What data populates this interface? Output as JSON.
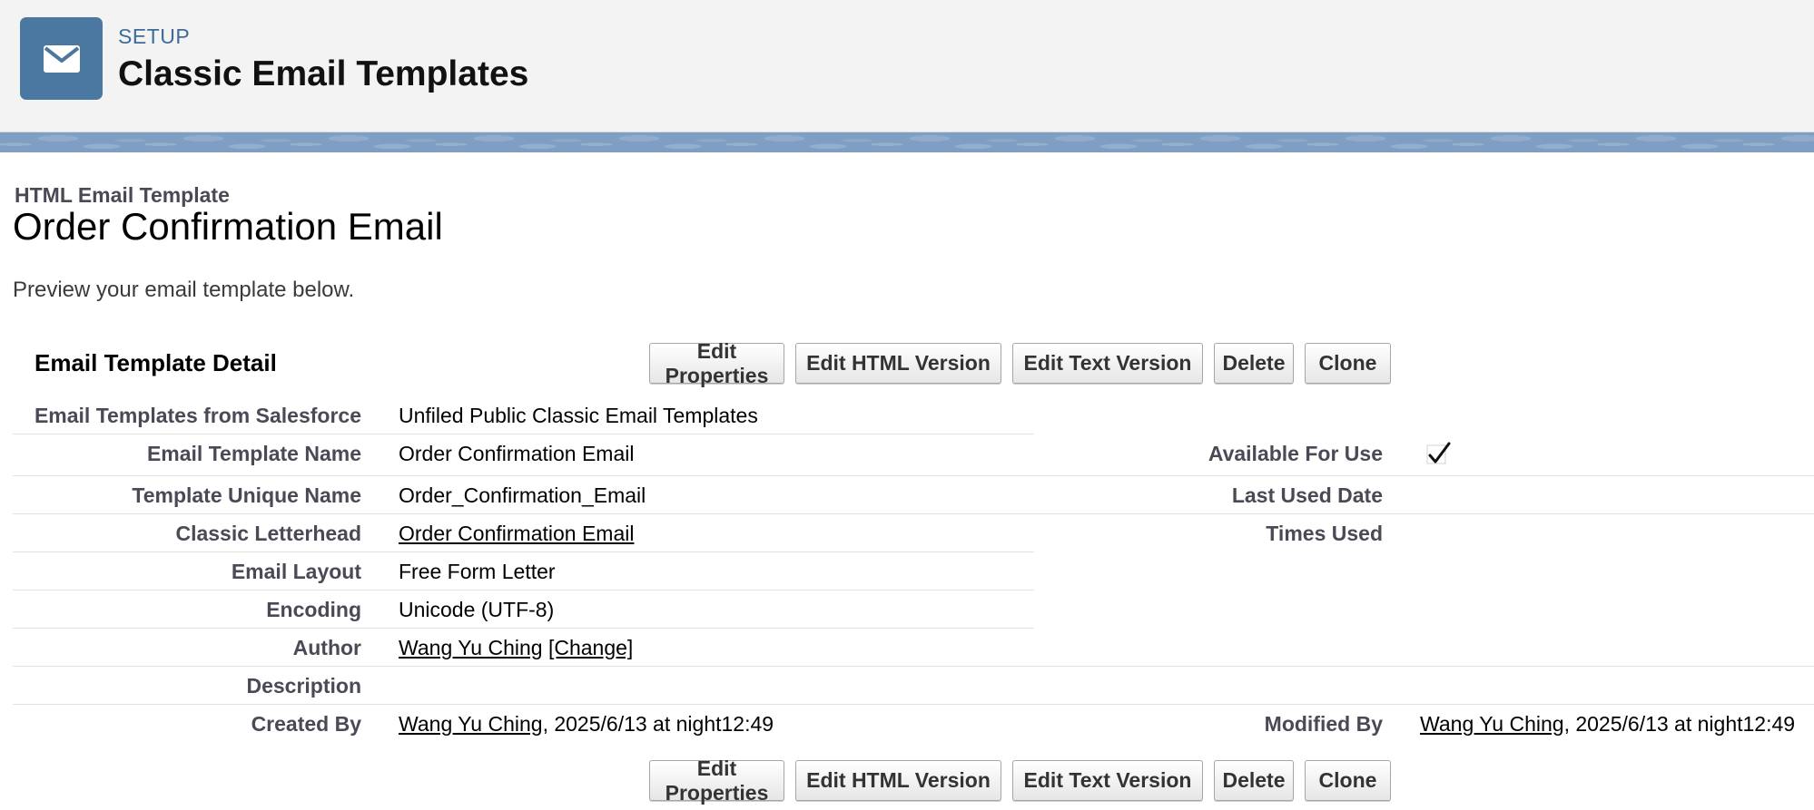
{
  "header": {
    "eyebrow": "SETUP",
    "title": "Classic Email Templates",
    "icon": "email-envelope-icon",
    "icon_bg": "#4a78a0"
  },
  "template": {
    "type_label": "HTML Email Template",
    "name": "Order Confirmation Email",
    "preview_text": "Preview your email template below."
  },
  "detail": {
    "section_title": "Email Template Detail",
    "buttons": [
      "Edit Properties",
      "Edit HTML Version",
      "Edit Text Version",
      "Delete",
      "Clone"
    ],
    "fields": {
      "folder": {
        "label": "Email Templates from Salesforce",
        "value": "Unfiled Public Classic Email Templates"
      },
      "template_name": {
        "label": "Email Template Name",
        "value": "Order Confirmation Email"
      },
      "unique_name": {
        "label": "Template Unique Name",
        "value": "Order_Confirmation_Email"
      },
      "letterhead": {
        "label": "Classic Letterhead",
        "value": "Order Confirmation Email"
      },
      "layout": {
        "label": "Email Layout",
        "value": "Free Form Letter"
      },
      "encoding": {
        "label": "Encoding",
        "value": "Unicode (UTF-8)"
      },
      "author": {
        "label": "Author",
        "value": "Wang Yu Ching",
        "change": "[Change]"
      },
      "description": {
        "label": "Description",
        "value": ""
      },
      "created_by": {
        "label": "Created By",
        "user": "Wang Yu Ching",
        "date": ", 2025/6/13 at night12:49"
      },
      "available": {
        "label": "Available For Use",
        "checked": true,
        "icon": "checkmark-icon"
      },
      "last_used": {
        "label": "Last Used Date",
        "value": ""
      },
      "times_used": {
        "label": "Times Used",
        "value": ""
      },
      "modified_by": {
        "label": "Modified By",
        "user": "Wang Yu Ching",
        "date": ", 2025/6/13 at night12:49"
      }
    }
  }
}
